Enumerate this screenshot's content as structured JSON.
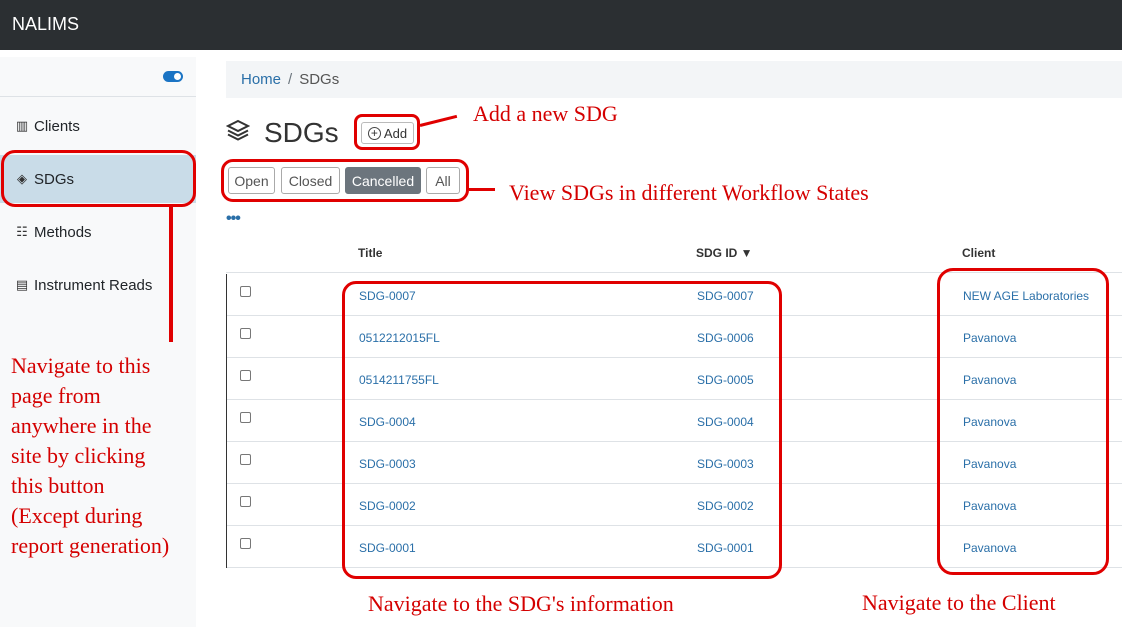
{
  "app": {
    "title": "NALIMS"
  },
  "sidebar": {
    "items": [
      {
        "label": "Clients",
        "icon": "building-icon"
      },
      {
        "label": "SDGs",
        "icon": "layers-icon"
      },
      {
        "label": "Methods",
        "icon": "list-icon"
      },
      {
        "label": "Instrument Reads",
        "icon": "file-icon"
      }
    ]
  },
  "breadcrumb": {
    "home": "Home",
    "separator": "/",
    "current": "SDGs"
  },
  "page": {
    "title": "SDGs",
    "add_label": "Add"
  },
  "workflow_filters": [
    "Open",
    "Closed",
    "Cancelled",
    "All"
  ],
  "table": {
    "columns": [
      "Title",
      "SDG ID ▼",
      "Client"
    ],
    "rows": [
      {
        "title": "SDG-0007",
        "sdg_id": "SDG-0007",
        "client": "NEW AGE Laboratories"
      },
      {
        "title": "0512212015FL",
        "sdg_id": "SDG-0006",
        "client": "Pavanova"
      },
      {
        "title": "0514211755FL",
        "sdg_id": "SDG-0005",
        "client": "Pavanova"
      },
      {
        "title": "SDG-0004",
        "sdg_id": "SDG-0004",
        "client": "Pavanova"
      },
      {
        "title": "SDG-0003",
        "sdg_id": "SDG-0003",
        "client": "Pavanova"
      },
      {
        "title": "SDG-0002",
        "sdg_id": "SDG-0002",
        "client": "Pavanova"
      },
      {
        "title": "SDG-0001",
        "sdg_id": "SDG-0001",
        "client": "Pavanova"
      }
    ]
  },
  "annotations": {
    "add": "Add a new SDG",
    "workflow": "View SDGs in different Workflow States",
    "sidebar_lines": [
      "Navigate to this",
      "page from",
      "anywhere in the",
      "site by clicking",
      "this button",
      "(Except during",
      "report generation)"
    ],
    "sdg_info": "Navigate to the SDG's information",
    "client": "Navigate to the Client"
  },
  "colors": {
    "annotation": "#e00000",
    "link": "#2a6fa8",
    "topbar": "#2b2f32",
    "active_sidebar": "#c9dce8"
  }
}
